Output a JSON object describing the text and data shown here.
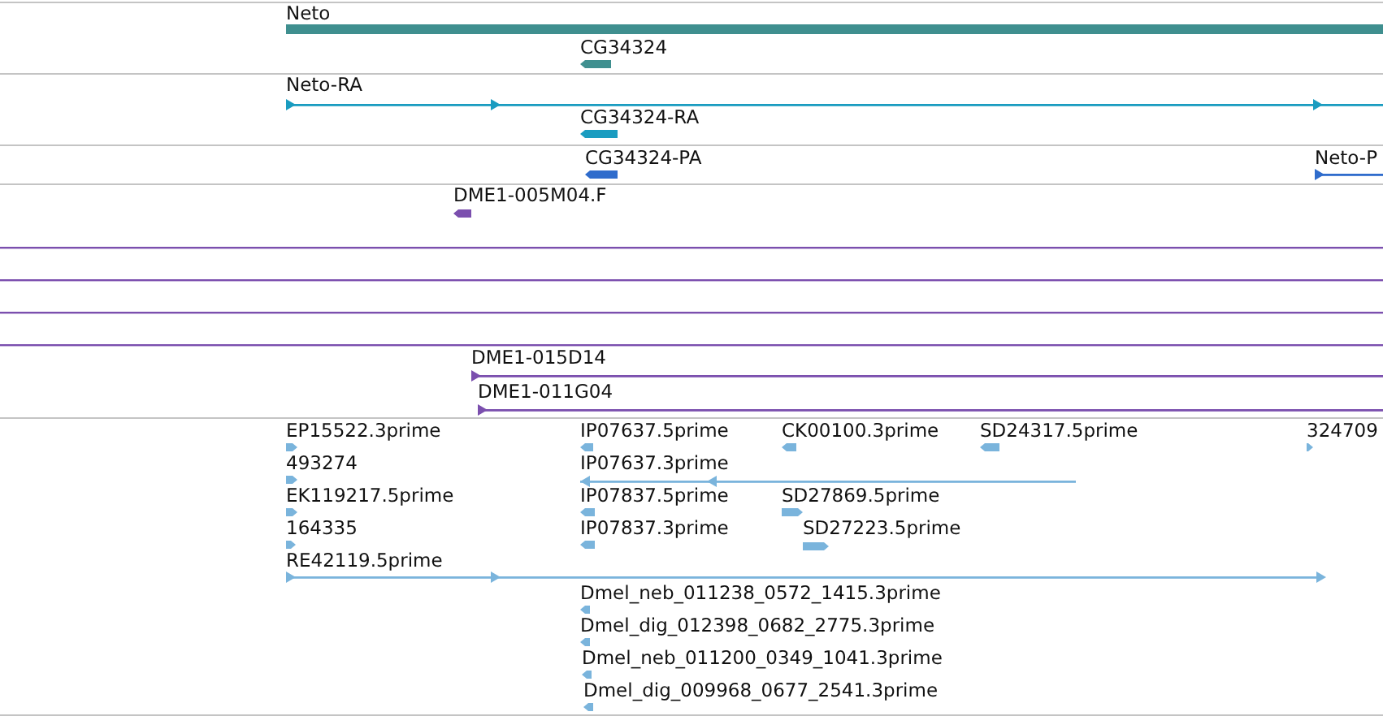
{
  "tracks": [
    {
      "color": "#3f8f8f",
      "features": [
        {
          "label": "Neto",
          "kind": "bar"
        },
        {
          "label": "CG34324",
          "kind": "block",
          "reverse": true
        }
      ]
    },
    {
      "color": "#1a9cc0",
      "features": [
        {
          "label": "Neto-RA",
          "kind": "transcript",
          "reverse": false
        },
        {
          "label": "CG34324-RA",
          "kind": "block",
          "reverse": true
        }
      ]
    },
    {
      "color": "#2f6ccc",
      "features": [
        {
          "label": "CG34324-PA",
          "kind": "block",
          "reverse": true
        },
        {
          "label": "Neto-P",
          "kind": "transcript",
          "reverse": false
        }
      ]
    },
    {
      "color": "#7b4fae",
      "features": [
        {
          "label": "DME1-005M04.F",
          "kind": "block",
          "reverse": true
        },
        {
          "kind": "rule"
        },
        {
          "kind": "rule"
        },
        {
          "kind": "rule"
        },
        {
          "kind": "rule"
        },
        {
          "label": "DME1-015D14",
          "kind": "transcript",
          "reverse": false
        },
        {
          "label": "DME1-011G04",
          "kind": "transcript",
          "reverse": false
        }
      ]
    },
    {
      "color": "#7ab4dc",
      "features": [
        {
          "label": "EP15522.3prime",
          "kind": "block",
          "reverse": false
        },
        {
          "label": "IP07637.5prime",
          "kind": "block",
          "reverse": true
        },
        {
          "label": "CK00100.3prime",
          "kind": "block",
          "reverse": true
        },
        {
          "label": "SD24317.5prime",
          "kind": "block",
          "reverse": true
        },
        {
          "label": "324709",
          "kind": "block",
          "reverse": false
        },
        {
          "label": "493274",
          "kind": "block",
          "reverse": false
        },
        {
          "label": "IP07637.3prime",
          "kind": "transcript",
          "reverse": true
        },
        {
          "label": "EK119217.5prime",
          "kind": "block",
          "reverse": false
        },
        {
          "label": "IP07837.5prime",
          "kind": "block",
          "reverse": true
        },
        {
          "label": "SD27869.5prime",
          "kind": "block",
          "reverse": false
        },
        {
          "label": "164335",
          "kind": "block",
          "reverse": false
        },
        {
          "label": "IP07837.3prime",
          "kind": "block",
          "reverse": true
        },
        {
          "label": "SD27223.5prime",
          "kind": "block",
          "reverse": false
        },
        {
          "label": "RE42119.5prime",
          "kind": "transcript",
          "reverse": false
        },
        {
          "label": "Dmel_neb_011238_0572_1415.3prime",
          "kind": "block",
          "reverse": true
        },
        {
          "label": "Dmel_dig_012398_0682_2775.3prime",
          "kind": "block",
          "reverse": true
        },
        {
          "label": "Dmel_neb_011200_0349_1041.3prime",
          "kind": "block",
          "reverse": true
        },
        {
          "label": "Dmel_dig_009968_0677_2541.3prime",
          "kind": "block",
          "reverse": true
        }
      ]
    }
  ]
}
